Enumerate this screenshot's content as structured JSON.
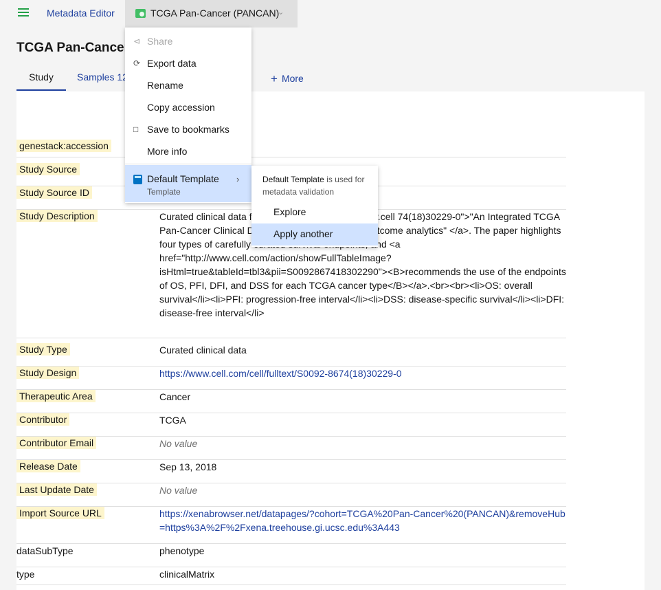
{
  "topbar": {
    "app_name": "Metadata Editor",
    "study_switcher": "TCGA Pan-Cancer (PANCAN)"
  },
  "page_title": "TCGA Pan-Cancer",
  "tabs": {
    "study": "Study",
    "samples": "Samples 12",
    "more": "More"
  },
  "menu": {
    "share": "Share",
    "export": "Export data",
    "rename": "Rename",
    "copy_accession": "Copy accession",
    "save_bookmarks": "Save to bookmarks",
    "more_info": "More info",
    "template_label": "Default Template",
    "template_sub": "Template"
  },
  "submenu": {
    "info_name": "Default Template",
    "info_text": " is used for metadata validation",
    "explore": "Explore",
    "apply_another": "Apply another"
  },
  "rows": [
    {
      "key": "genestack:accession",
      "value": "",
      "highlight": true
    },
    {
      "key": "Study Source",
      "value": "",
      "highlight": true
    },
    {
      "key": "Study Source ID",
      "value": "",
      "highlight": true
    },
    {
      "key": "Study Description",
      "value": "Curated clinical data f                                    per titled <a href=\"http://www.cell                                        74(18)30229-0\">\"An Integrated TCGA Pan-Cancer Clinical Data R                                  high quality survival outcome analytics\" </a>. The paper highlights four types of carefully curated survival endpoints, and <a href=\"http://www.cell.com/action/showFullTableImage?isHtml=true&tableId=tbl3&pii=S0092867418302290\"><B>recommends the use of the endpoints of OS, PFI, DFI, and DSS for each TCGA cancer type</B></a>.<br><br><li>OS: overall survival</li><li>PFI: progression-free interval</li><li>DSS: disease-specific survival</li><li>DFI: disease-free interval</li>",
      "highlight": true
    },
    {
      "key": "Study Type",
      "value": "Curated clinical data",
      "highlight": true
    },
    {
      "key": "Study Design",
      "value": "https://www.cell.com/cell/fulltext/S0092-8674(18)30229-0",
      "highlight": true,
      "link": true
    },
    {
      "key": "Therapeutic Area",
      "value": "Cancer",
      "highlight": true
    },
    {
      "key": "Contributor",
      "value": "TCGA",
      "highlight": true
    },
    {
      "key": "Contributor Email",
      "value": "No value",
      "highlight": true,
      "empty": true
    },
    {
      "key": "Release Date",
      "value": "Sep 13, 2018",
      "highlight": true
    },
    {
      "key": "Last Update Date",
      "value": "No value",
      "highlight": true,
      "empty": true
    },
    {
      "key": "Import Source URL",
      "value": "https://xenabrowser.net/datapages/?cohort=TCGA%20Pan-Cancer%20(PANCAN)&removeHub=https%3A%2F%2Fxena.treehouse.gi.ucsc.edu%3A443",
      "highlight": true,
      "link": true
    },
    {
      "key": "dataSubType",
      "value": "phenotype",
      "highlight": false
    },
    {
      "key": "type",
      "value": "clinicalMatrix",
      "highlight": false
    }
  ]
}
